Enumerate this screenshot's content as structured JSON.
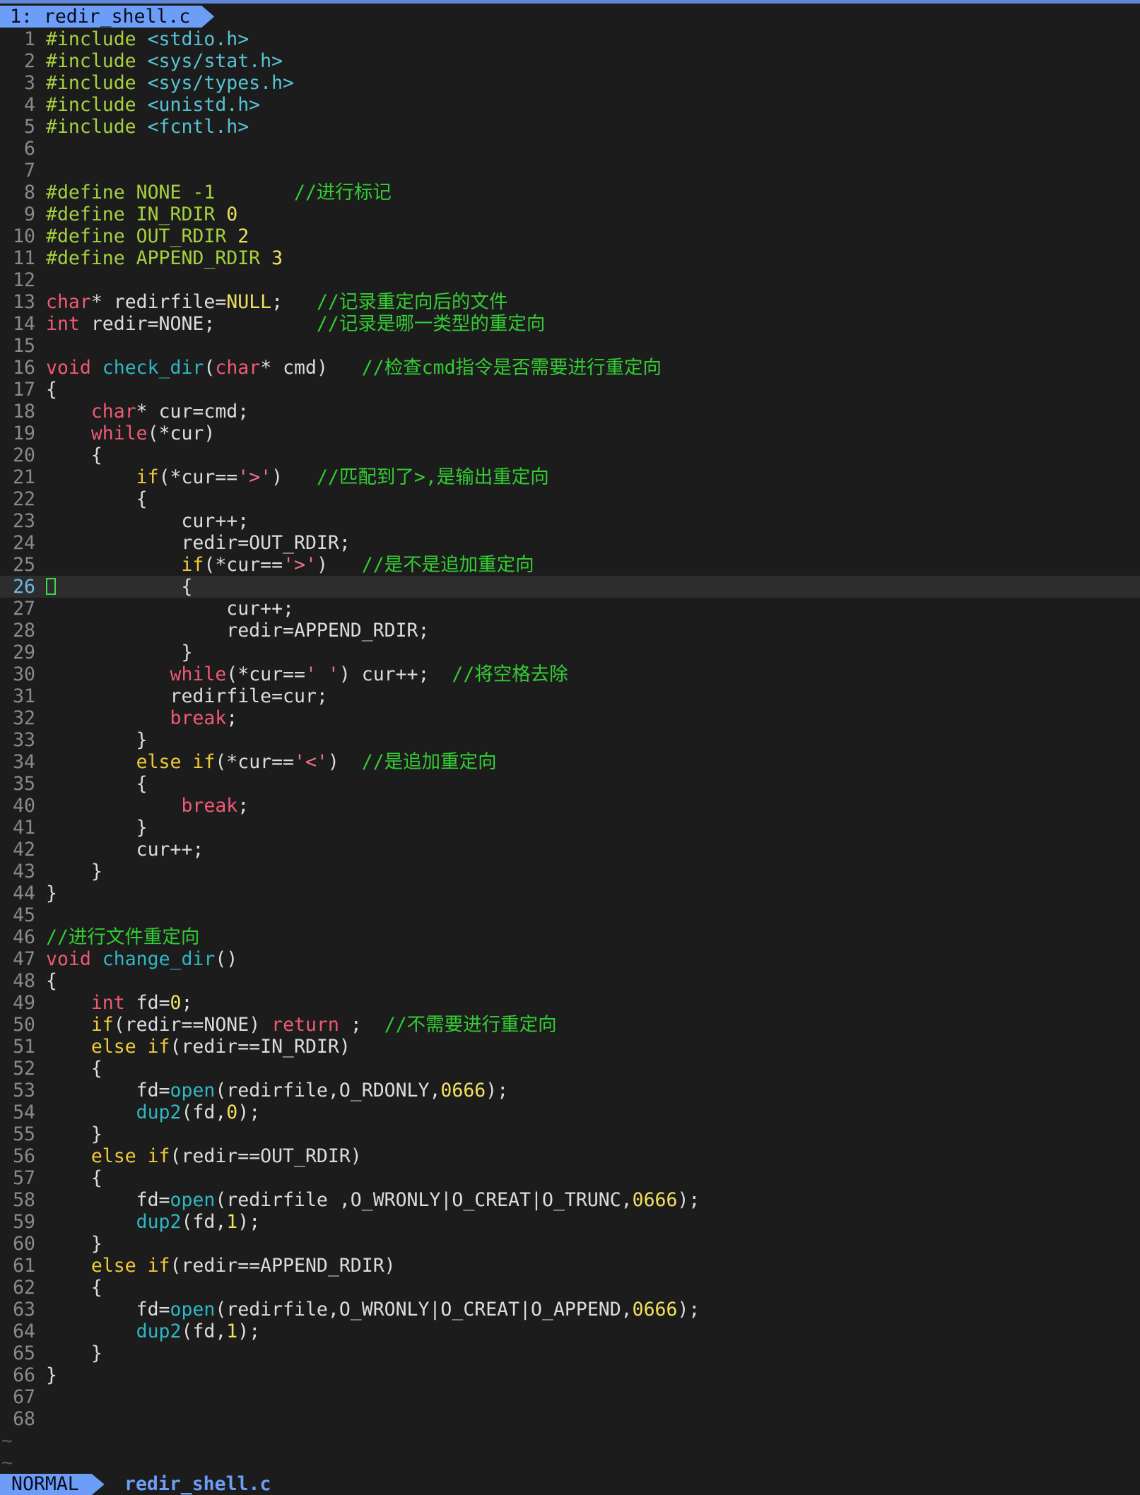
{
  "tab": {
    "label": "1: redir_shell.c"
  },
  "editor": {
    "cursor_line": 26,
    "lines": [
      {
        "n": "1",
        "t": [
          [
            "#include ",
            "pre"
          ],
          [
            "<stdio.h>",
            "hdr"
          ]
        ]
      },
      {
        "n": "2",
        "t": [
          [
            "#include ",
            "pre"
          ],
          [
            "<sys/stat.h>",
            "hdr"
          ]
        ]
      },
      {
        "n": "3",
        "t": [
          [
            "#include ",
            "pre"
          ],
          [
            "<sys/types.h>",
            "hdr"
          ]
        ]
      },
      {
        "n": "4",
        "t": [
          [
            "#include ",
            "pre"
          ],
          [
            "<unistd.h>",
            "hdr"
          ]
        ]
      },
      {
        "n": "5",
        "t": [
          [
            "#include ",
            "pre"
          ],
          [
            "<fcntl.h>",
            "hdr"
          ]
        ]
      },
      {
        "n": "6",
        "t": []
      },
      {
        "n": "7",
        "t": []
      },
      {
        "n": "8",
        "t": [
          [
            "#define NONE -1       ",
            "pre"
          ],
          [
            "//进行标记",
            "com"
          ]
        ]
      },
      {
        "n": "9",
        "t": [
          [
            "#define IN_RDIR ",
            "pre"
          ],
          [
            "0",
            "num"
          ]
        ]
      },
      {
        "n": "10",
        "t": [
          [
            "#define OUT_RDIR ",
            "pre"
          ],
          [
            "2",
            "num"
          ]
        ]
      },
      {
        "n": "11",
        "t": [
          [
            "#define APPEND_RDIR ",
            "pre"
          ],
          [
            "3",
            "num"
          ]
        ]
      },
      {
        "n": "12",
        "t": []
      },
      {
        "n": "13",
        "t": [
          [
            "char",
            "type"
          ],
          [
            "* redirfile=",
            ""
          ],
          [
            "NULL",
            "null"
          ],
          [
            ";   ",
            ""
          ],
          [
            "//记录重定向后的文件",
            "com"
          ]
        ]
      },
      {
        "n": "14",
        "t": [
          [
            "int",
            "type"
          ],
          [
            " redir=NONE;         ",
            ""
          ],
          [
            "//记录是哪一类型的重定向",
            "com"
          ]
        ]
      },
      {
        "n": "15",
        "t": []
      },
      {
        "n": "16",
        "t": [
          [
            "void",
            "type"
          ],
          [
            " ",
            ""
          ],
          [
            "check_dir",
            "fn"
          ],
          [
            "(",
            ""
          ],
          [
            "char",
            "type"
          ],
          [
            "* cmd)   ",
            ""
          ],
          [
            "//检查cmd指令是否需要进行重定向",
            "com"
          ]
        ]
      },
      {
        "n": "17",
        "t": [
          [
            "{",
            ""
          ]
        ]
      },
      {
        "n": "18",
        "t": [
          [
            "    ",
            ""
          ],
          [
            "char",
            "type"
          ],
          [
            "* cur=cmd;",
            ""
          ]
        ]
      },
      {
        "n": "19",
        "t": [
          [
            "    ",
            ""
          ],
          [
            "while",
            "type"
          ],
          [
            "(*cur)",
            ""
          ]
        ]
      },
      {
        "n": "20",
        "t": [
          [
            "    {",
            ""
          ]
        ]
      },
      {
        "n": "21",
        "t": [
          [
            "        ",
            ""
          ],
          [
            "if",
            "ctl"
          ],
          [
            "(*cur==",
            ""
          ],
          [
            "'>'",
            "str"
          ],
          [
            ")   ",
            ""
          ],
          [
            "//匹配到了>,是输出重定向",
            "com"
          ]
        ]
      },
      {
        "n": "22",
        "t": [
          [
            "        {",
            ""
          ]
        ]
      },
      {
        "n": "23",
        "t": [
          [
            "            cur++;",
            ""
          ]
        ]
      },
      {
        "n": "24",
        "t": [
          [
            "            redir=OUT_RDIR;",
            ""
          ]
        ]
      },
      {
        "n": "25",
        "t": [
          [
            "            ",
            ""
          ],
          [
            "if",
            "ctl"
          ],
          [
            "(*cur==",
            ""
          ],
          [
            "'>'",
            "str"
          ],
          [
            ")   ",
            ""
          ],
          [
            "//是不是追加重定向",
            "com"
          ]
        ]
      },
      {
        "n": "26",
        "t": [
          [
            "            {",
            ""
          ]
        ]
      },
      {
        "n": "27",
        "t": [
          [
            "                cur++;",
            ""
          ]
        ]
      },
      {
        "n": "28",
        "t": [
          [
            "                redir=APPEND_RDIR;",
            ""
          ]
        ]
      },
      {
        "n": "29",
        "t": [
          [
            "            }",
            ""
          ]
        ]
      },
      {
        "n": "30",
        "t": [
          [
            "           ",
            ""
          ],
          [
            "while",
            "type"
          ],
          [
            "(*cur==",
            ""
          ],
          [
            "' '",
            "str"
          ],
          [
            ") cur++;  ",
            ""
          ],
          [
            "//将空格去除",
            "com"
          ]
        ]
      },
      {
        "n": "31",
        "t": [
          [
            "           redirfile=cur;",
            ""
          ]
        ]
      },
      {
        "n": "32",
        "t": [
          [
            "           ",
            ""
          ],
          [
            "break",
            "type"
          ],
          [
            ";",
            ""
          ]
        ]
      },
      {
        "n": "33",
        "t": [
          [
            "        }",
            ""
          ]
        ]
      },
      {
        "n": "34",
        "t": [
          [
            "        ",
            ""
          ],
          [
            "else if",
            "ctl"
          ],
          [
            "(*cur==",
            ""
          ],
          [
            "'<'",
            "str"
          ],
          [
            ")  ",
            ""
          ],
          [
            "//是追加重定向",
            "com"
          ]
        ]
      },
      {
        "n": "35",
        "t": [
          [
            "        {",
            ""
          ]
        ]
      },
      {
        "n": "40",
        "t": [
          [
            "            ",
            ""
          ],
          [
            "break",
            "type"
          ],
          [
            ";",
            ""
          ]
        ]
      },
      {
        "n": "41",
        "t": [
          [
            "        }",
            ""
          ]
        ]
      },
      {
        "n": "42",
        "t": [
          [
            "        cur++;",
            ""
          ]
        ]
      },
      {
        "n": "43",
        "t": [
          [
            "    }",
            ""
          ]
        ]
      },
      {
        "n": "44",
        "t": [
          [
            "}",
            ""
          ]
        ]
      },
      {
        "n": "45",
        "t": []
      },
      {
        "n": "46",
        "t": [
          [
            "//进行文件重定向",
            "com"
          ]
        ]
      },
      {
        "n": "47",
        "t": [
          [
            "void",
            "type"
          ],
          [
            " ",
            ""
          ],
          [
            "change_dir",
            "fn"
          ],
          [
            "()",
            ""
          ]
        ]
      },
      {
        "n": "48",
        "t": [
          [
            "{",
            ""
          ]
        ]
      },
      {
        "n": "49",
        "t": [
          [
            "    ",
            ""
          ],
          [
            "int",
            "type"
          ],
          [
            " fd=",
            ""
          ],
          [
            "0",
            "num"
          ],
          [
            ";",
            ""
          ]
        ]
      },
      {
        "n": "50",
        "t": [
          [
            "    ",
            ""
          ],
          [
            "if",
            "ctl"
          ],
          [
            "(redir==NONE) ",
            ""
          ],
          [
            "return",
            "type"
          ],
          [
            " ;  ",
            ""
          ],
          [
            "//不需要进行重定向",
            "com"
          ]
        ]
      },
      {
        "n": "51",
        "t": [
          [
            "    ",
            ""
          ],
          [
            "else if",
            "ctl"
          ],
          [
            "(redir==IN_RDIR)",
            ""
          ]
        ]
      },
      {
        "n": "52",
        "t": [
          [
            "    {",
            ""
          ]
        ]
      },
      {
        "n": "53",
        "t": [
          [
            "        fd=",
            ""
          ],
          [
            "open",
            "fn"
          ],
          [
            "(redirfile,O_RDONLY,",
            ""
          ],
          [
            "0666",
            "num"
          ],
          [
            ");",
            ""
          ]
        ]
      },
      {
        "n": "54",
        "t": [
          [
            "        ",
            ""
          ],
          [
            "dup2",
            "fn"
          ],
          [
            "(fd,",
            ""
          ],
          [
            "0",
            "num"
          ],
          [
            ");",
            ""
          ]
        ]
      },
      {
        "n": "55",
        "t": [
          [
            "    }",
            ""
          ]
        ]
      },
      {
        "n": "56",
        "t": [
          [
            "    ",
            ""
          ],
          [
            "else if",
            "ctl"
          ],
          [
            "(redir==OUT_RDIR)",
            ""
          ]
        ]
      },
      {
        "n": "57",
        "t": [
          [
            "    {",
            ""
          ]
        ]
      },
      {
        "n": "58",
        "t": [
          [
            "        fd=",
            ""
          ],
          [
            "open",
            "fn"
          ],
          [
            "(redirfile ,O_WRONLY|O_CREAT|O_TRUNC,",
            ""
          ],
          [
            "0666",
            "num"
          ],
          [
            ");",
            ""
          ]
        ]
      },
      {
        "n": "59",
        "t": [
          [
            "        ",
            ""
          ],
          [
            "dup2",
            "fn"
          ],
          [
            "(fd,",
            ""
          ],
          [
            "1",
            "num"
          ],
          [
            ");",
            ""
          ]
        ]
      },
      {
        "n": "60",
        "t": [
          [
            "    }",
            ""
          ]
        ]
      },
      {
        "n": "61",
        "t": [
          [
            "    ",
            ""
          ],
          [
            "else if",
            "ctl"
          ],
          [
            "(redir==APPEND_RDIR)",
            ""
          ]
        ]
      },
      {
        "n": "62",
        "t": [
          [
            "    {",
            ""
          ]
        ]
      },
      {
        "n": "63",
        "t": [
          [
            "        fd=",
            ""
          ],
          [
            "open",
            "fn"
          ],
          [
            "(redirfile,O_WRONLY|O_CREAT|O_APPEND,",
            ""
          ],
          [
            "0666",
            "num"
          ],
          [
            ");",
            ""
          ]
        ]
      },
      {
        "n": "64",
        "t": [
          [
            "        ",
            ""
          ],
          [
            "dup2",
            "fn"
          ],
          [
            "(fd,",
            ""
          ],
          [
            "1",
            "num"
          ],
          [
            ");",
            ""
          ]
        ]
      },
      {
        "n": "65",
        "t": [
          [
            "    }",
            ""
          ]
        ]
      },
      {
        "n": "66",
        "t": [
          [
            "}",
            ""
          ]
        ]
      },
      {
        "n": "67",
        "t": []
      },
      {
        "n": "68",
        "t": []
      }
    ],
    "tildes": [
      "~",
      "~"
    ]
  },
  "statusline": {
    "mode": "NORMAL",
    "filename": "redir_shell.c"
  },
  "colors": {
    "background": "#1c1c1c",
    "accent": "#6c9ef8",
    "comment": "#33cc33",
    "keyword": "#f05a73",
    "control": "#f0ca3a",
    "function": "#2fb7c4"
  }
}
